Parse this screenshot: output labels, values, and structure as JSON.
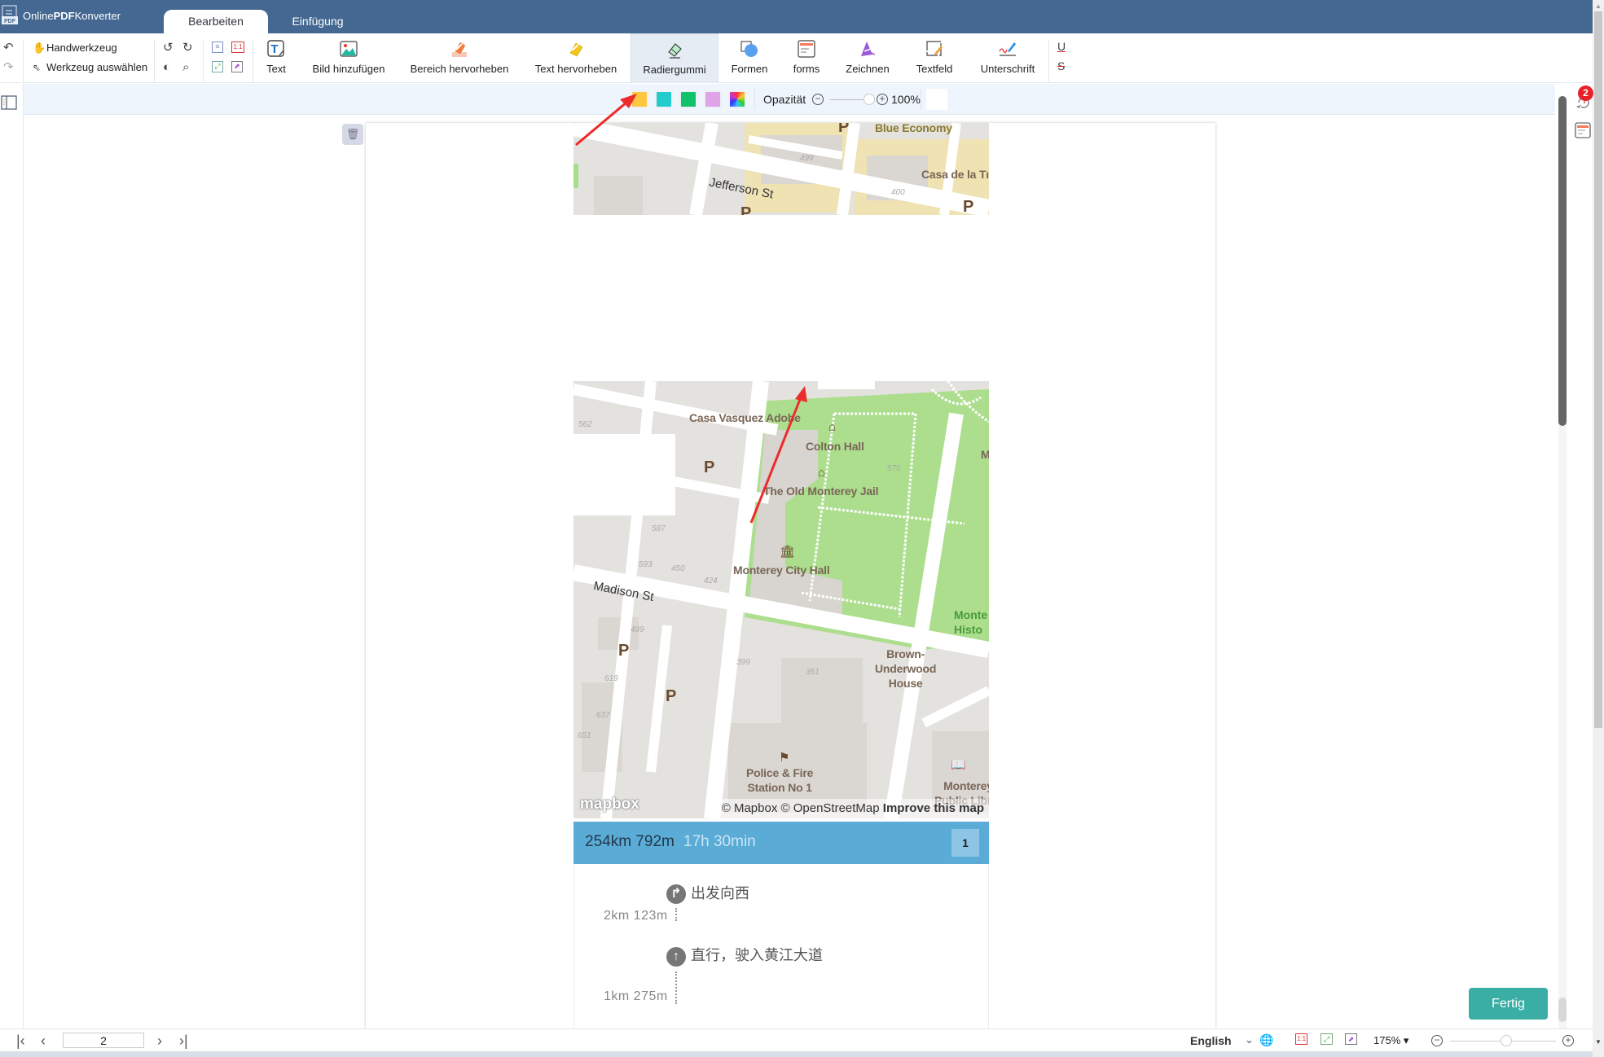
{
  "app": {
    "title_prefix": "Online",
    "title_bold": "PDF",
    "title_suffix": "Konverter",
    "logo_text": "PDF"
  },
  "tabs": [
    {
      "label": "Bearbeiten",
      "active": true
    },
    {
      "label": "Einfügung",
      "active": false
    }
  ],
  "toolbar": {
    "hand_tool": "Handwerkzeug",
    "select_tool": "Werkzeug auswählen",
    "fit_label": "1:1",
    "tools": [
      {
        "label": "Text",
        "icon": "text-tool-icon"
      },
      {
        "label": "Bild hinzufügen",
        "icon": "image-icon"
      },
      {
        "label": "Bereich hervorheben",
        "icon": "area-highlight-icon"
      },
      {
        "label": "Text hervorheben",
        "icon": "highlighter-icon"
      },
      {
        "label": "Radiergummi",
        "icon": "eraser-icon",
        "active": true
      },
      {
        "label": "Formen",
        "icon": "shapes-icon"
      },
      {
        "label": "forms",
        "icon": "forms-icon"
      },
      {
        "label": "Zeichnen",
        "icon": "draw-icon"
      },
      {
        "label": "Textfeld",
        "icon": "textfield-icon"
      },
      {
        "label": "Unterschrift",
        "icon": "signature-icon"
      }
    ],
    "underline_glyph": "U",
    "strike_glyph": "S"
  },
  "subbar": {
    "colors": [
      "#ffc740",
      "#22cccc",
      "#11c26d",
      "#e0a3e8"
    ],
    "opacity_label": "Opazität",
    "opacity_value": "100%",
    "opacity_percent": 100
  },
  "map_top": {
    "labels": {
      "blue_economy": "Blue Economy",
      "casa_tr": "Casa de la Tı",
      "jefferson": "Jefferson St"
    },
    "house_numbers": [
      "499",
      "400"
    ]
  },
  "map_main": {
    "labels": {
      "casa_vasquez": "Casa Vasquez Adobe",
      "colton_hall": "Colton Hall",
      "old_jail": "The Old Monterey Jail",
      "city_hall": "Monterey City Hall",
      "madison": "Madison St",
      "brown_underwood": "Brown-\nUnderwood\nHouse",
      "police_fire": "Police & Fire\nStation No 1",
      "library": "Monterey\nPublic Librar",
      "monte_histo": "Monte\nHisto",
      "m_edge": "M"
    },
    "house_numbers": [
      "562",
      "570",
      "587",
      "593",
      "450",
      "424",
      "499",
      "619",
      "637",
      "651",
      "399",
      "351"
    ],
    "parking": "P",
    "attribution": "© Mapbox © OpenStreetMap",
    "improve": "Improve this map",
    "mapbox_logo": "mapbox"
  },
  "route": {
    "distance": "254km 792m",
    "duration": "17h 30min",
    "badge": "1",
    "steps": [
      {
        "text": "出发向西",
        "distance": "2km 123m",
        "icon": "turn-right-icon"
      },
      {
        "text": "直行，驶入黄江大道",
        "distance": "1km 275m",
        "icon": "straight-arrow-icon"
      }
    ]
  },
  "right_sidebar": {
    "notification_count": "2"
  },
  "done_button": "Fertig",
  "statusbar": {
    "page_number": "2",
    "language": "English",
    "fit_label": "1:1",
    "zoom": "175%"
  }
}
